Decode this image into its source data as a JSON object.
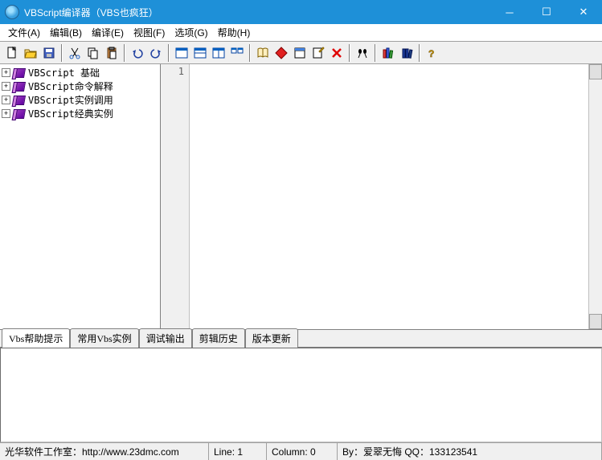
{
  "title": "VBScript编译器（VBS也疯狂）",
  "menu": [
    "文件(A)",
    "编辑(B)",
    "编译(E)",
    "视图(F)",
    "选项(G)",
    "帮助(H)"
  ],
  "tree": [
    {
      "label": "VBScript 基础"
    },
    {
      "label": "VBScript命令解释"
    },
    {
      "label": "VBScript实例调用"
    },
    {
      "label": "VBScript经典实例"
    }
  ],
  "gutter": "1",
  "tabs": [
    "Vbs帮助提示",
    "常用Vbs实例",
    "调试输出",
    "剪辑历史",
    "版本更新"
  ],
  "status": {
    "workshop": "光华软件工作室：http://www.23dmc.com",
    "line": "Line: 1",
    "column": "Column: 0",
    "by": "By：爱翠无悔  QQ：133123541"
  }
}
